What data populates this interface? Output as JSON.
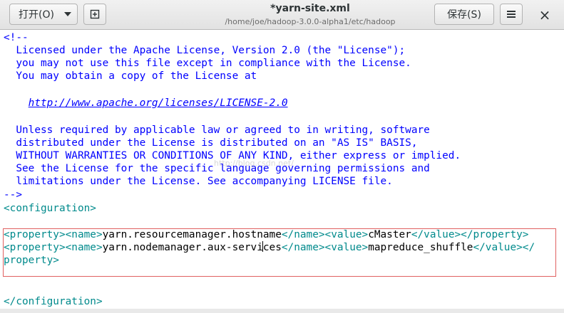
{
  "header": {
    "open_label": "打开(O)",
    "new_tab_icon": "new-document-icon",
    "title": "*yarn-site.xml",
    "subtitle": "/home/joe/hadoop-3.0.0-alpha1/etc/hadoop",
    "save_label": "保存(S)",
    "menu_icon": "hamburger-icon",
    "close_glyph": "×"
  },
  "editor": {
    "comment_open": "<!--",
    "license": {
      "l1": "  Licensed under the Apache License, Version 2.0 (the \"License\");",
      "l2": "  you may not use this file except in compliance with the License.",
      "l3": "  You may obtain a copy of the License at",
      "url": "http://www.apache.org/licenses/LICENSE-2.0",
      "l5": "  Unless required by applicable law or agreed to in writing, software",
      "l6": "  distributed under the License is distributed on an \"AS IS\" BASIS,",
      "l7": "  WITHOUT WARRANTIES OR CONDITIONS OF ANY KIND, either express or implied.",
      "l8": "  See the License for the specific language governing permissions and",
      "l9": "  limitations under the License. See accompanying LICENSE file."
    },
    "comment_close": "-->",
    "config_open": "<configuration>",
    "prop1": {
      "open": "<property><name>",
      "name": "yarn.resourcemanager.hostname",
      "mid": "</name><value>",
      "value": "cMaster",
      "close": "</value></property>"
    },
    "prop2": {
      "open": "<property><name>",
      "name_a": "yarn.nodemanager.aux-servi",
      "name_b": "ces",
      "mid": "</name><value>",
      "value": "mapreduce_shuffle",
      "close_a": "</value></",
      "close_b": "property>"
    },
    "config_close": "</configuration>",
    "watermark": "http://blog.csdn.net/"
  },
  "colors": {
    "comment": "#0000ff",
    "tag": "#008a8c",
    "text": "#000000",
    "highlight_border": "#e06060"
  }
}
